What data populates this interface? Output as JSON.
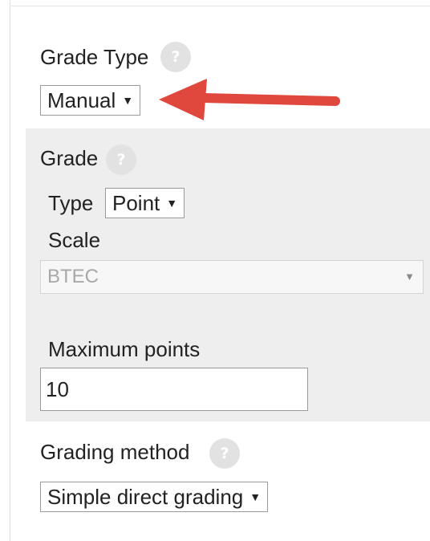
{
  "grade_type": {
    "label": "Grade Type",
    "help_icon": "?",
    "select_value": "Manual"
  },
  "grade": {
    "heading": "Grade",
    "help_icon": "?",
    "type_label": "Type",
    "type_value": "Point",
    "scale_label": "Scale",
    "scale_value": "BTEC",
    "maximum_points_label": "Maximum points",
    "maximum_points_value": "10"
  },
  "grading_method": {
    "label": "Grading method",
    "help_icon": "?",
    "select_value": "Simple direct grading"
  },
  "colors": {
    "annotation_arrow": "#e0473d",
    "panel_background": "#eeeeee",
    "help_icon_background": "#e2e2e2"
  },
  "icons": {
    "help": "question-mark-circle",
    "select_caret": "triangle-down",
    "annotation": "arrow-left"
  }
}
